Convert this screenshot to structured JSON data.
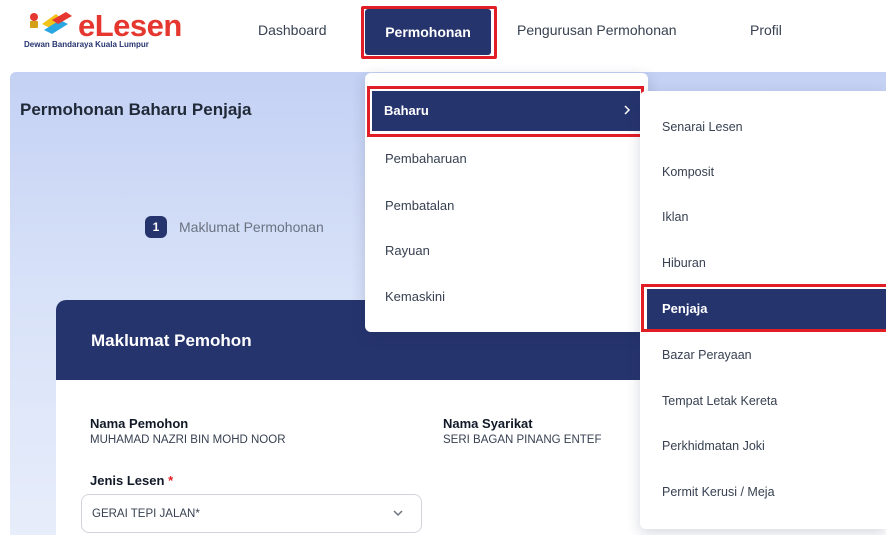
{
  "header": {
    "brand": "eLesen",
    "brand_sub": "Dewan Bandaraya Kuala Lumpur",
    "nav": {
      "dashboard": "Dashboard",
      "permohonan": "Permohonan",
      "pengurusan": "Pengurusan Permohonan",
      "profil": "Profil"
    }
  },
  "page": {
    "title": "Permohonan Baharu Penjaja",
    "step_number": "1",
    "step_label": "Maklumat Permohonan"
  },
  "card": {
    "title": "Maklumat Pemohon",
    "nama_pemohon_label": "Nama Pemohon",
    "nama_pemohon_value": "MUHAMAD NAZRI BIN MOHD NOOR",
    "nama_syarikat_label": "Nama Syarikat",
    "nama_syarikat_value": "SERI BAGAN PINANG ENTEF",
    "jenis_lesen_label": "Jenis Lesen",
    "required_mark": "*",
    "jenis_lesen_value": "GERAI TEPI JALAN*"
  },
  "menu_level1": {
    "active": "Baharu",
    "items": [
      "Pembaharuan",
      "Pembatalan",
      "Rayuan",
      "Kemaskini"
    ]
  },
  "menu_level2": {
    "items_before": [
      "Senarai Lesen",
      "Komposit",
      "Iklan",
      "Hiburan"
    ],
    "active": "Penjaja",
    "items_after": [
      "Bazar Perayaan",
      "Tempat Letak Kereta",
      "Perkhidmatan Joki",
      "Permit Kerusi / Meja"
    ]
  },
  "colors": {
    "primary": "#26346e",
    "highlight": "#e11d26",
    "brand": "#e5372f"
  },
  "icons": [
    "logo-icon",
    "chevron-right-icon",
    "chevron-down-icon"
  ]
}
